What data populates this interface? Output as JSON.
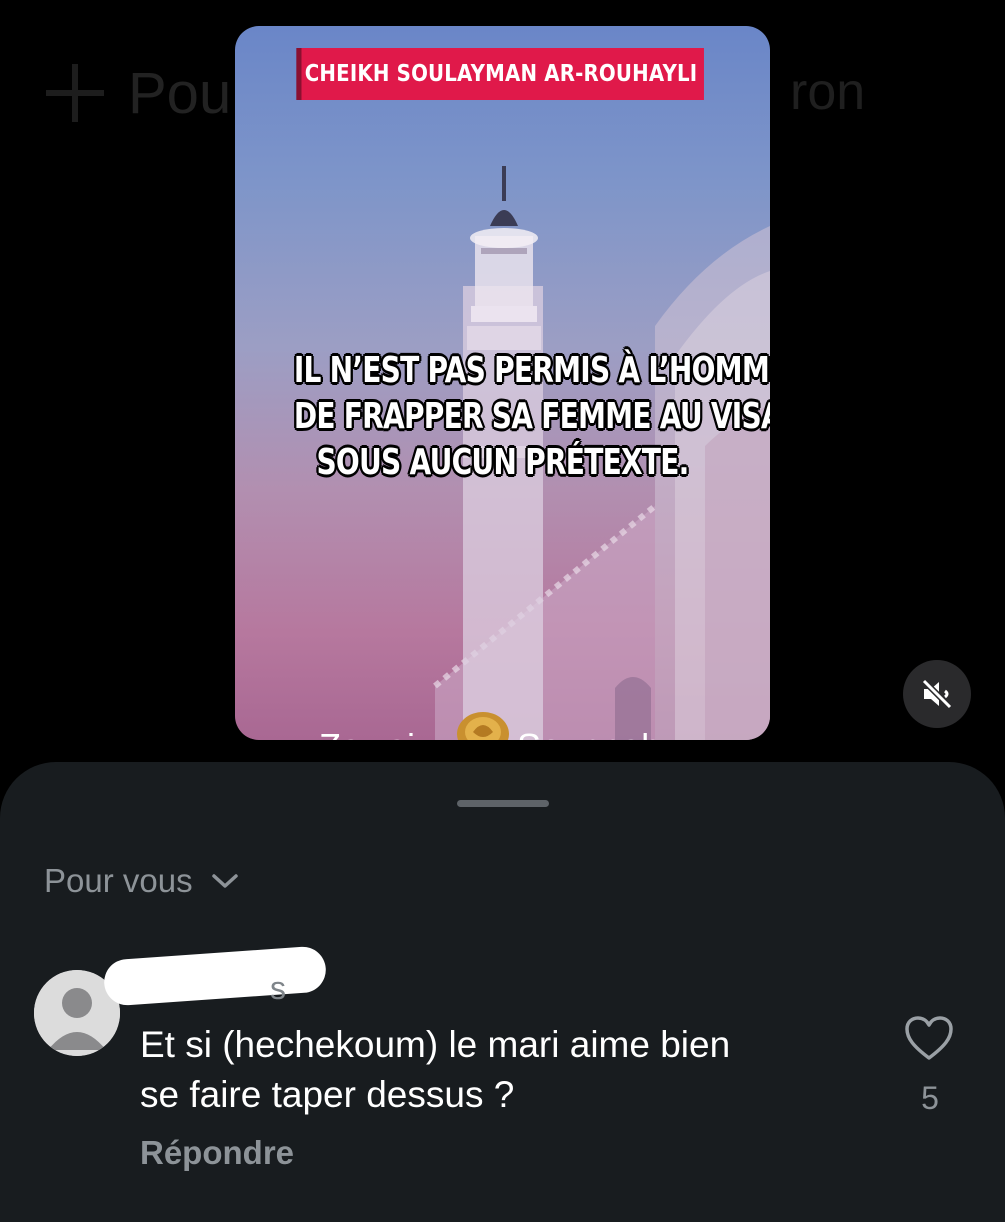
{
  "background": {
    "header_text": "Pou",
    "header_tail": "ron"
  },
  "video": {
    "title": "CHEIKH SOULAYMAN AR-ROUHAYLI",
    "quote_lines": [
      "IL N’EST PAS PERMIS À L’HOMME",
      "DE FRAPPER SA FEMME AU VISAGE,",
      "SOUS AUCUN PRÉTEXTE."
    ],
    "brand_left": "Zawaj",
    "brand_right": "Sounnah",
    "title_color": "#e0194a"
  },
  "mute_button": {
    "icon": "speaker-muted-icon"
  },
  "comments_sheet": {
    "filter_label": "Pour vous",
    "filter_icon": "chevron-down-icon",
    "comments": [
      {
        "time_ago": "s",
        "text_line1": "Et si (hechekoum) le mari aime bien",
        "text_line2": "se faire taper dessus ?",
        "reply_label": "Répondre",
        "like_icon": "heart-icon",
        "like_count": "5"
      }
    ]
  }
}
